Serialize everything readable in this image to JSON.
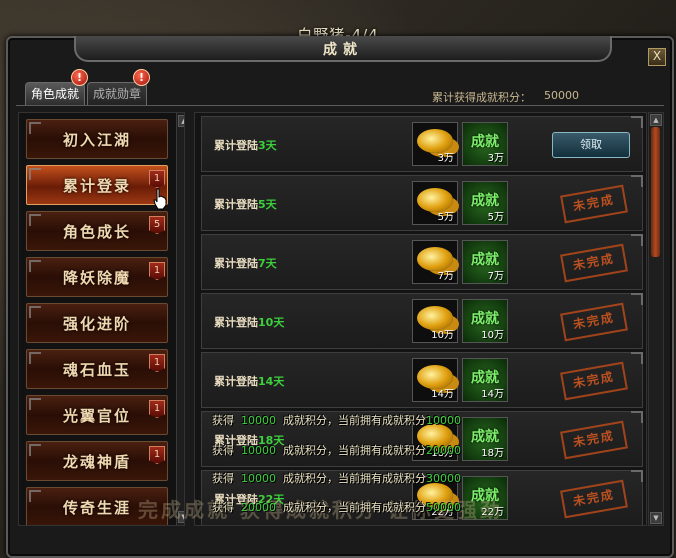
{
  "map": {
    "title": "白野猪-4/4"
  },
  "window": {
    "title": "成就",
    "close_label": "X"
  },
  "tabs": [
    {
      "label": "角色成就",
      "alert": "!"
    },
    {
      "label": "成就勋章",
      "alert": "!"
    }
  ],
  "summary": {
    "label": "累计获得成就积分：",
    "value": "50000"
  },
  "categories": [
    {
      "label": "初入江湖",
      "badge": ""
    },
    {
      "label": "累计登录",
      "badge": "1"
    },
    {
      "label": "角色成长",
      "badge": "5"
    },
    {
      "label": "降妖除魔",
      "badge": "1"
    },
    {
      "label": "强化进阶",
      "badge": ""
    },
    {
      "label": "魂石血玉",
      "badge": "1"
    },
    {
      "label": "光翼官位",
      "badge": "1"
    },
    {
      "label": "龙魂神盾",
      "badge": "1"
    },
    {
      "label": "传奇生涯",
      "badge": ""
    }
  ],
  "achievements": [
    {
      "prefix": "累计登陆",
      "num": "3",
      "suffix": "天",
      "gold_qty": "3万",
      "ach_qty": "3万",
      "ach_text": "成就",
      "status": "claim",
      "status_label": "领取"
    },
    {
      "prefix": "累计登陆",
      "num": "5",
      "suffix": "天",
      "gold_qty": "5万",
      "ach_qty": "5万",
      "ach_text": "成就",
      "status": "incomplete",
      "status_label": "未完成"
    },
    {
      "prefix": "累计登陆",
      "num": "7",
      "suffix": "天",
      "gold_qty": "7万",
      "ach_qty": "7万",
      "ach_text": "成就",
      "status": "incomplete",
      "status_label": "未完成"
    },
    {
      "prefix": "累计登陆",
      "num": "10",
      "suffix": "天",
      "gold_qty": "10万",
      "ach_qty": "10万",
      "ach_text": "成就",
      "status": "incomplete",
      "status_label": "未完成"
    },
    {
      "prefix": "累计登陆",
      "num": "14",
      "suffix": "天",
      "gold_qty": "14万",
      "ach_qty": "14万",
      "ach_text": "成就",
      "status": "incomplete",
      "status_label": "未完成"
    },
    {
      "prefix": "累计登陆",
      "num": "18",
      "suffix": "天",
      "gold_qty": "18万",
      "ach_qty": "18万",
      "ach_text": "成就",
      "status": "incomplete",
      "status_label": "未完成"
    },
    {
      "prefix": "累计登陆",
      "num": "22",
      "suffix": "天",
      "gold_qty": "22万",
      "ach_qty": "22万",
      "ach_text": "成就",
      "status": "incomplete",
      "status_label": "未完成"
    }
  ],
  "toasts": [
    {
      "a": "获得",
      "v": "10000",
      "b": "成就积分，当前拥有成就积分",
      "t": "10000"
    },
    {
      "a": "获得",
      "v": "10000",
      "b": "成就积分，当前拥有成就积分",
      "t": "20000"
    },
    {
      "a": "获得",
      "v": "10000",
      "b": "成就积分，当前拥有成就积分",
      "t": "30000"
    },
    {
      "a": "获得",
      "v": "20000",
      "b": "成就积分，当前拥有成就积分",
      "t": "50000"
    }
  ],
  "banner": "完成成就 获得成就积分 让你更强劲"
}
